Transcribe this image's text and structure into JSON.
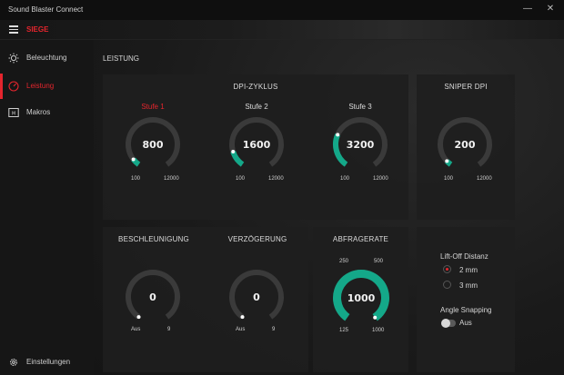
{
  "window": {
    "title": "Sound Blaster Connect",
    "minimize_icon": "minimize-icon",
    "close_icon": "close-icon"
  },
  "header": {
    "profile": "SIEGE",
    "menu_icon": "hamburger-icon"
  },
  "sidebar": {
    "items": [
      {
        "label": "Beleuchtung",
        "icon": "bulb-icon",
        "active": false
      },
      {
        "label": "Leistung",
        "icon": "speedometer-icon",
        "active": true
      },
      {
        "label": "Makros",
        "icon": "macro-icon",
        "active": false
      }
    ],
    "settings": {
      "label": "Einstellungen",
      "icon": "gear-icon"
    }
  },
  "main": {
    "section_title": "LEISTUNG",
    "dpi_cycle": {
      "title": "DPI-ZYKLUS",
      "stages": [
        {
          "label": "Stufe 1",
          "value": "800",
          "min": "100",
          "max": "12000",
          "level": 0.06,
          "active": true
        },
        {
          "label": "Stufe 2",
          "value": "1600",
          "min": "100",
          "max": "12000",
          "level": 0.13,
          "active": false
        },
        {
          "label": "Stufe 3",
          "value": "3200",
          "min": "100",
          "max": "12000",
          "level": 0.27,
          "active": false
        }
      ]
    },
    "sniper": {
      "title": "SNIPER DPI",
      "value": "200",
      "min": "100",
      "max": "12000",
      "level": 0.01
    },
    "acceleration": {
      "title": "BESCHLEUNIGUNG",
      "value": "0",
      "min": "Aus",
      "max": "9",
      "level": 0
    },
    "deceleration": {
      "title": "VERZÖGERUNG",
      "value": "0",
      "min": "Aus",
      "max": "9",
      "level": 0
    },
    "polling": {
      "title": "ABFRAGERATE",
      "value": "1000",
      "labels": {
        "top_left": "250",
        "top_right": "500",
        "bottom_left": "125",
        "bottom_right": "1000"
      },
      "level": 1
    },
    "liftoff": {
      "title": "Lift-Off Distanz",
      "options": [
        {
          "label": "2 mm",
          "selected": true
        },
        {
          "label": "3 mm",
          "selected": false
        }
      ]
    },
    "angle_snapping": {
      "title": "Angle Snapping",
      "state": "Aus",
      "on": false
    }
  },
  "colors": {
    "accent": "#e5252d",
    "gauge_fill": "#14a889",
    "gauge_track": "#3a3a3a",
    "panel": "#1e1e1e"
  }
}
